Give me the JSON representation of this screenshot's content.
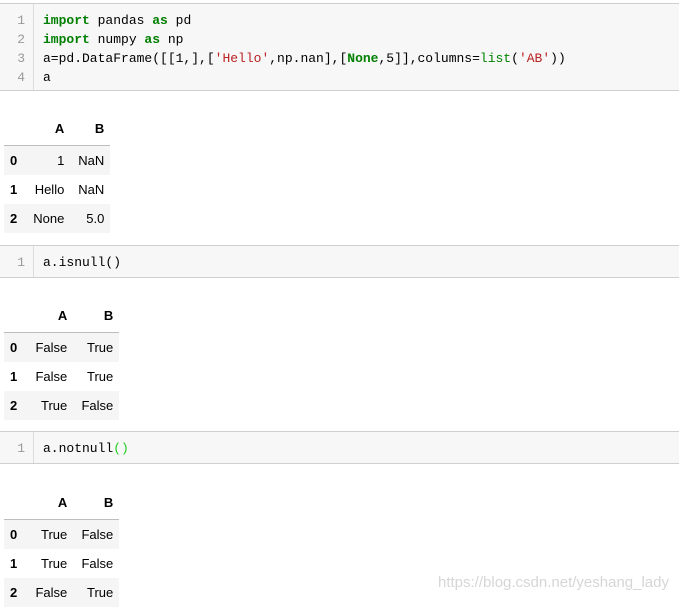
{
  "cells": [
    {
      "lines": [
        "1",
        "2",
        "3",
        "4"
      ],
      "code": [
        [
          {
            "t": "import",
            "c": "kw"
          },
          {
            "t": " pandas ",
            "c": ""
          },
          {
            "t": "as",
            "c": "kw"
          },
          {
            "t": " pd",
            "c": ""
          }
        ],
        [
          {
            "t": "import",
            "c": "kw"
          },
          {
            "t": " numpy ",
            "c": ""
          },
          {
            "t": "as",
            "c": "kw"
          },
          {
            "t": " np",
            "c": ""
          }
        ],
        [
          {
            "t": "a=pd.DataFrame([[1,],[",
            "c": ""
          },
          {
            "t": "'Hello'",
            "c": "str"
          },
          {
            "t": ",np.nan],[",
            "c": ""
          },
          {
            "t": "None",
            "c": "kw"
          },
          {
            "t": ",5]],columns=",
            "c": ""
          },
          {
            "t": "list",
            "c": "builtin"
          },
          {
            "t": "(",
            "c": ""
          },
          {
            "t": "'AB'",
            "c": "str"
          },
          {
            "t": "))",
            "c": ""
          }
        ],
        [
          {
            "t": "a",
            "c": ""
          }
        ]
      ],
      "output": {
        "columns": [
          "A",
          "B"
        ],
        "rows": [
          {
            "index": "0",
            "values": [
              "1",
              "NaN"
            ]
          },
          {
            "index": "1",
            "values": [
              "Hello",
              "NaN"
            ]
          },
          {
            "index": "2",
            "values": [
              "None",
              "5.0"
            ]
          }
        ]
      }
    },
    {
      "lines": [
        "1"
      ],
      "code": [
        [
          {
            "t": "a.isnull()",
            "c": ""
          }
        ]
      ],
      "output": {
        "columns": [
          "A",
          "B"
        ],
        "rows": [
          {
            "index": "0",
            "values": [
              "False",
              "True"
            ]
          },
          {
            "index": "1",
            "values": [
              "False",
              "True"
            ]
          },
          {
            "index": "2",
            "values": [
              "True",
              "False"
            ]
          }
        ]
      }
    },
    {
      "lines": [
        "1"
      ],
      "code": [
        [
          {
            "t": "a.notnull",
            "c": ""
          },
          {
            "t": "()",
            "c": "paren-hl"
          }
        ]
      ],
      "output": {
        "columns": [
          "A",
          "B"
        ],
        "rows": [
          {
            "index": "0",
            "values": [
              "True",
              "False"
            ]
          },
          {
            "index": "1",
            "values": [
              "True",
              "False"
            ]
          },
          {
            "index": "2",
            "values": [
              "False",
              "True"
            ]
          }
        ]
      }
    }
  ],
  "watermark": "https://blog.csdn.net/yeshang_lady"
}
